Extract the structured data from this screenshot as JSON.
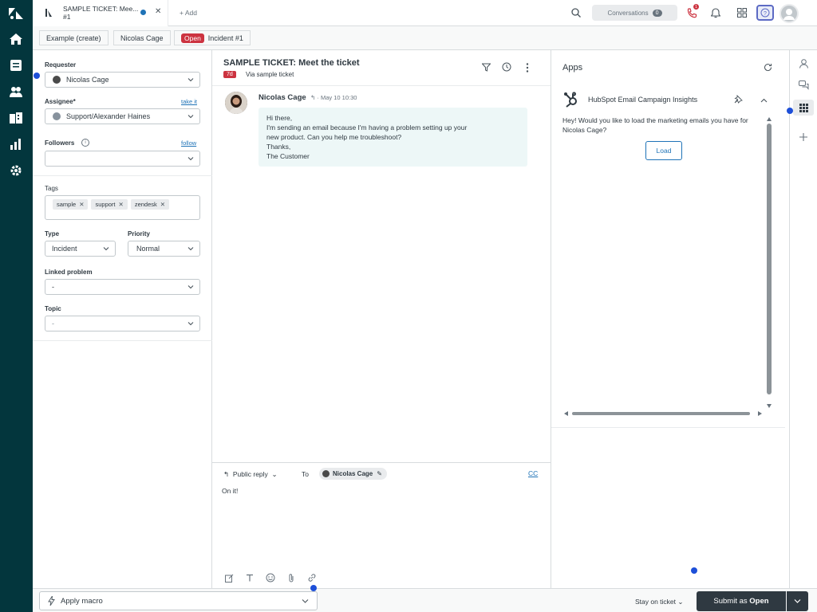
{
  "topbar": {
    "tab_title_line1": "SAMPLE TICKET: Mee...",
    "tab_title_line2": "#1",
    "add_label": "+ Add",
    "conversations_label": "Conversations",
    "conversations_count": "0",
    "phone_badge": "1"
  },
  "breadcrumbs": {
    "item1": "Example (create)",
    "item2": "Nicolas Cage",
    "status": "Open",
    "item3": "Incident #1"
  },
  "properties": {
    "requester_label": "Requester",
    "requester_value": "Nicolas Cage",
    "assignee_label": "Assignee*",
    "take_it": "take it",
    "assignee_value": "Support/Alexander Haines",
    "followers_label": "Followers",
    "follow_link": "follow",
    "tags_label": "Tags",
    "tags": [
      "sample",
      "support",
      "zendesk"
    ],
    "type_label": "Type",
    "type_value": "Incident",
    "priority_label": "Priority",
    "priority_value": "Normal",
    "linked_label": "Linked problem",
    "linked_value": "-",
    "topic_label": "Topic",
    "topic_value": "-"
  },
  "conversation": {
    "title": "SAMPLE TICKET: Meet the ticket",
    "age": "7d",
    "via": "Via sample ticket",
    "author": "Nicolas Cage",
    "timestamp": "May 10 10:30",
    "body_line1": "Hi there,",
    "body_line2": "I'm sending an email because I'm having a problem setting up your",
    "body_line3": "new product. Can you help me troubleshoot?",
    "body_line4": "Thanks,",
    "body_line5": "The Customer"
  },
  "apps": {
    "title": "Apps",
    "app_name": "HubSpot Email Campaign Insights",
    "app_text": "Hey! Would you like to load the marketing emails you have for Nicolas Cage?",
    "load_label": "Load"
  },
  "composer": {
    "reply_type": "Public reply",
    "to_label": "To",
    "to_recipient": "Nicolas Cage",
    "cc_label": "CC",
    "body": "On it!"
  },
  "bottom": {
    "macro_label": "Apply macro",
    "stay_label": "Stay on ticket",
    "submit_prefix": "Submit as",
    "submit_status": "Open"
  },
  "colors": {
    "nav_bg": "#03363d",
    "status_red": "#cc3340",
    "link_blue": "#1f73b7",
    "submit_bg": "#2f3941"
  }
}
